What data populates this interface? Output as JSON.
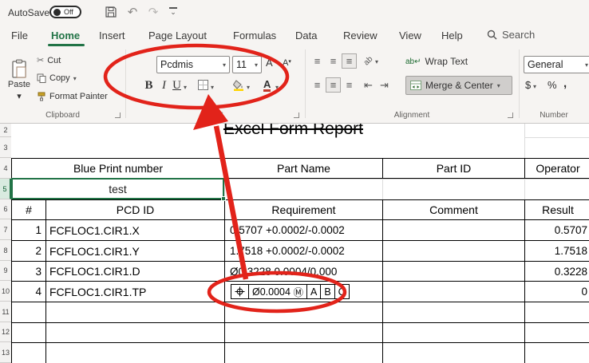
{
  "titlebar": {
    "autosave_label": "AutoSave",
    "autosave_state": "Off"
  },
  "tabs": {
    "file": "File",
    "home": "Home",
    "insert": "Insert",
    "page_layout": "Page Layout",
    "formulas": "Formulas",
    "data": "Data",
    "review": "Review",
    "view": "View",
    "help": "Help",
    "search_label": "Search"
  },
  "ribbon": {
    "clipboard": {
      "group_label": "Clipboard",
      "paste_label": "Paste",
      "cut_label": "Cut",
      "copy_label": "Copy",
      "format_painter_label": "Format Painter"
    },
    "font": {
      "group_label": "Font",
      "font_name": "Pcdmis",
      "font_size": "11",
      "bold_label": "B",
      "italic_label": "I",
      "underline_label": "U",
      "grow_label": "A",
      "shrink_label": "A",
      "color_label": "A"
    },
    "alignment": {
      "group_label": "Alignment",
      "wrap_text_label": "Wrap Text",
      "merge_center_label": "Merge & Center"
    },
    "number": {
      "group_label": "Number",
      "format_value": "General",
      "currency_label": "$",
      "percent_label": "%",
      "comma_label": ","
    }
  },
  "icons": {
    "dropdown": "▾",
    "undo": "↶",
    "redo": "↷",
    "scissors": "✂",
    "align": "≡",
    "outdent": "⇤",
    "indent": "⇥",
    "more": "⌄",
    "wrap_letters": "ab",
    "orient_letters": "ab"
  },
  "sheet": {
    "title": "Excel Form Report",
    "row_numbers": [
      "2",
      "3",
      "4",
      "5",
      "6",
      "7",
      "8",
      "9",
      "10",
      "11",
      "12",
      "13"
    ],
    "top_headers": {
      "blueprint": "Blue Print number",
      "part_name": "Part Name",
      "part_id": "Part ID",
      "operator": "Operator"
    },
    "blueprint_value": "test",
    "col_headers": {
      "num": "#",
      "pcd_id": "PCD ID",
      "requirement": "Requirement",
      "comment": "Comment",
      "result": "Result"
    },
    "rows": [
      {
        "num": "1",
        "pcd_id": "FCFLOC1.CIR1.X",
        "requirement": "0.5707  +0.0002/-0.0002",
        "comment": "",
        "result": "0.5707"
      },
      {
        "num": "2",
        "pcd_id": "FCFLOC1.CIR1.Y",
        "requirement": "1.7518  +0.0002/-0.0002",
        "comment": "",
        "result": "1.7518"
      },
      {
        "num": "3",
        "pcd_id": "FCFLOC1.CIR1.D",
        "requirement": "Ø0.3228  0.0004/0.000",
        "comment": "",
        "result": "0.3228"
      },
      {
        "num": "4",
        "pcd_id": "FCFLOC1.CIR1.TP",
        "comment": "",
        "result": "0"
      }
    ],
    "fcf": {
      "tolerance": "Ø0.0004",
      "modifier": "Ⓜ",
      "datum_a": "A",
      "datum_b": "B",
      "datum_c": "C"
    }
  },
  "colors": {
    "accent_green": "#217346",
    "annotation_red": "#e2231a"
  }
}
